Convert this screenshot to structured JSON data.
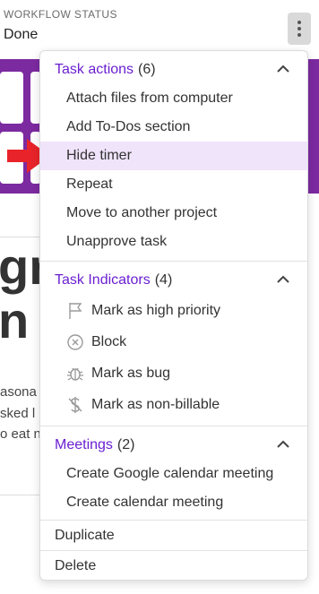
{
  "background": {
    "status_label": "WORKFLOW STATUS",
    "status_value": "Done",
    "big_text_1": "gr",
    "big_text_2": "n",
    "partial_lines": [
      "asona",
      "sked l",
      "o eat n"
    ]
  },
  "menu": {
    "task_actions": {
      "title": "Task actions",
      "count": "(6)",
      "items": [
        "Attach files from computer",
        "Add To-Dos section",
        "Hide timer",
        "Repeat",
        "Move to another project",
        "Unapprove task"
      ],
      "highlighted": "Hide timer"
    },
    "task_indicators": {
      "title": "Task Indicators",
      "count": "(4)",
      "items": [
        {
          "label": "Mark as high priority",
          "icon": "flag-icon"
        },
        {
          "label": "Block",
          "icon": "block-icon"
        },
        {
          "label": "Mark as bug",
          "icon": "bug-icon"
        },
        {
          "label": "Mark as non-billable",
          "icon": "non-billable-icon"
        }
      ]
    },
    "meetings": {
      "title": "Meetings",
      "count": "(2)",
      "items": [
        "Create Google calendar meeting",
        "Create calendar meeting"
      ]
    },
    "duplicate_label": "Duplicate",
    "delete_label": "Delete"
  },
  "colors": {
    "accent": "#6a1fd0",
    "highlight": "#efe4fa",
    "band": "#7c2aa0",
    "arrow": "#e8242a"
  }
}
